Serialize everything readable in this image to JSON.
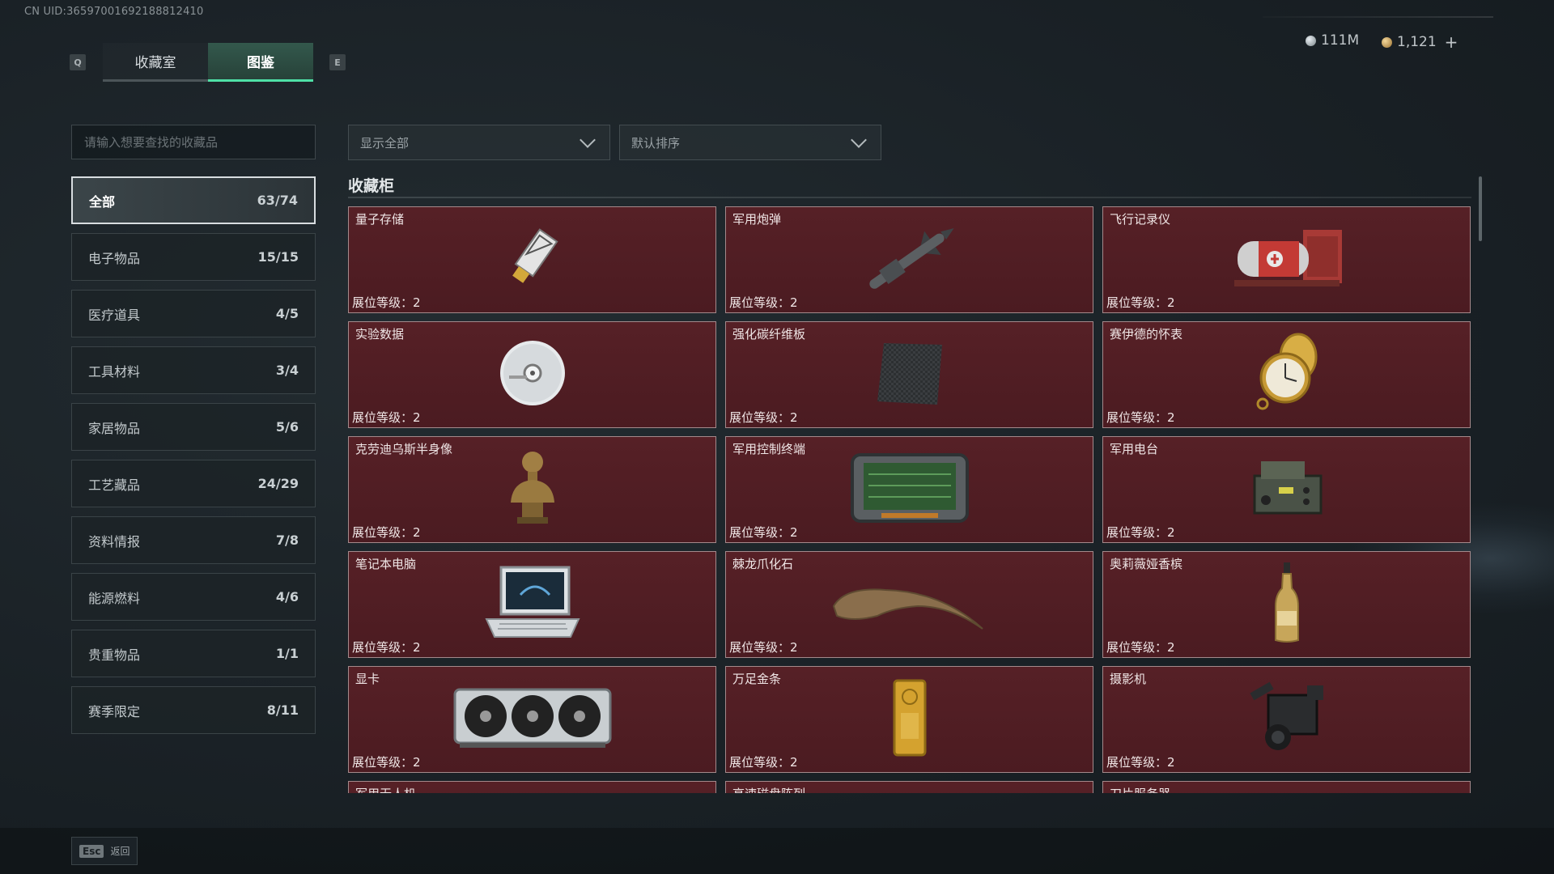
{
  "uid": "CN UID:36597001692188812410",
  "hotkeys": {
    "prev_tab": "Q",
    "next_tab": "E"
  },
  "tabs": [
    {
      "label": "收藏室",
      "active": false
    },
    {
      "label": "图鉴",
      "active": true
    }
  ],
  "currency": {
    "silver": "111M",
    "gold": "1,121",
    "add_label": "+"
  },
  "search": {
    "placeholder": "请输入想要查找的收藏品"
  },
  "filters": {
    "display": "显示全部",
    "sort": "默认排序"
  },
  "categories": [
    {
      "label": "全部",
      "count": "63/74",
      "active": true
    },
    {
      "label": "电子物品",
      "count": "15/15"
    },
    {
      "label": "医疗道具",
      "count": "4/5"
    },
    {
      "label": "工具材料",
      "count": "3/4"
    },
    {
      "label": "家居物品",
      "count": "5/6"
    },
    {
      "label": "工艺藏品",
      "count": "24/29"
    },
    {
      "label": "资料情报",
      "count": "7/8"
    },
    {
      "label": "能源燃料",
      "count": "4/6"
    },
    {
      "label": "贵重物品",
      "count": "1/1"
    },
    {
      "label": "赛季限定",
      "count": "8/11"
    }
  ],
  "section": {
    "title": "收藏柜"
  },
  "level_label": "展位等级：",
  "items": [
    {
      "name": "量子存储",
      "level": "2",
      "icon": "usb-drive-icon"
    },
    {
      "name": "军用炮弹",
      "level": "2",
      "icon": "missile-icon"
    },
    {
      "name": "飞行记录仪",
      "level": "2",
      "icon": "flight-recorder-icon"
    },
    {
      "name": "实验数据",
      "level": "2",
      "icon": "disc-icon"
    },
    {
      "name": "强化碳纤维板",
      "level": "2",
      "icon": "carbon-plate-icon"
    },
    {
      "name": "赛伊德的怀表",
      "level": "2",
      "icon": "pocket-watch-icon"
    },
    {
      "name": "克劳迪乌斯半身像",
      "level": "2",
      "icon": "bust-statue-icon"
    },
    {
      "name": "军用控制终端",
      "level": "2",
      "icon": "control-terminal-icon"
    },
    {
      "name": "军用电台",
      "level": "2",
      "icon": "radio-icon"
    },
    {
      "name": "笔记本电脑",
      "level": "2",
      "icon": "laptop-icon"
    },
    {
      "name": "棘龙爪化石",
      "level": "2",
      "icon": "claw-fossil-icon"
    },
    {
      "name": "奥莉薇娅香槟",
      "level": "2",
      "icon": "champagne-icon"
    },
    {
      "name": "显卡",
      "level": "2",
      "icon": "gpu-icon"
    },
    {
      "name": "万足金条",
      "level": "2",
      "icon": "gold-bar-icon"
    },
    {
      "name": "摄影机",
      "level": "2",
      "icon": "camera-icon"
    },
    {
      "name": "军用无人机",
      "level": "",
      "icon": ""
    },
    {
      "name": "高速磁盘阵列",
      "level": "",
      "icon": ""
    },
    {
      "name": "刀片服务器",
      "level": "",
      "icon": ""
    }
  ],
  "footer": {
    "esc_key": "Esc",
    "back_label": "返回"
  },
  "colors": {
    "accent": "#4fe0a6",
    "card_bg": "#53202a",
    "card_border": "#a4898b"
  }
}
